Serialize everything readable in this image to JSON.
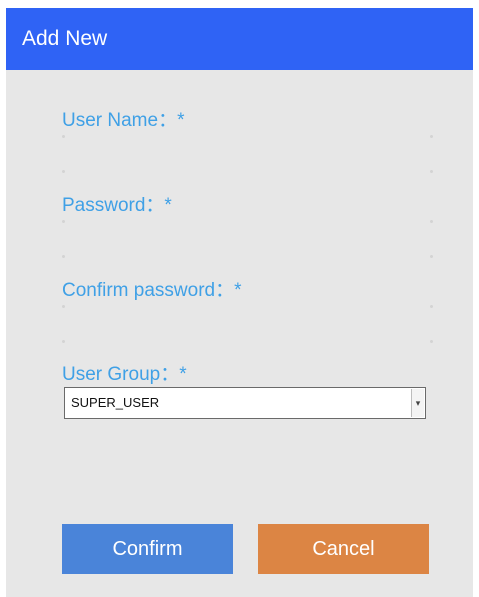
{
  "dialog": {
    "title": "Add New",
    "colors": {
      "titlebar": "#2f63f5",
      "label": "#3fa0e6",
      "background": "#e7e7e7",
      "confirm": "#4a84d9",
      "cancel": "#dc8544"
    }
  },
  "form": {
    "username_label": "User Name：*",
    "password_label": "Password：*",
    "confirm_password_label": "Confirm password：*",
    "user_group_label": "User Group：*",
    "username_value": "",
    "password_value": "",
    "confirm_password_value": "",
    "user_group_value": "SUPER_USER",
    "user_group_arrow_icon": "dropdown-arrow"
  },
  "buttons": {
    "confirm_label": "Confirm",
    "cancel_label": "Cancel"
  }
}
